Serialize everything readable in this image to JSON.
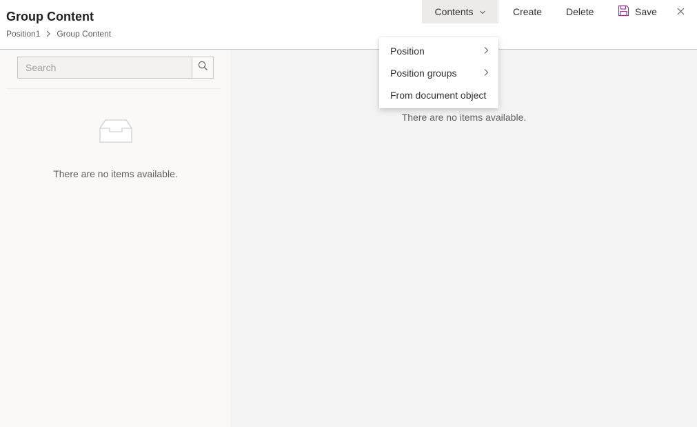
{
  "header": {
    "title": "Group Content",
    "breadcrumb": [
      "Position1",
      "Group Content"
    ]
  },
  "toolbar": {
    "contents_label": "Contents",
    "create_label": "Create",
    "delete_label": "Delete",
    "save_label": "Save"
  },
  "contents_menu": {
    "items": [
      {
        "label": "Position",
        "has_submenu": true
      },
      {
        "label": "Position groups",
        "has_submenu": true
      },
      {
        "label": "From document object",
        "has_submenu": false
      }
    ]
  },
  "left_panel": {
    "search_placeholder": "Search",
    "empty_message": "There are no items available."
  },
  "right_panel": {
    "empty_message": "There are no items available."
  },
  "colors": {
    "save_icon": "#8a3d8f",
    "active_button_bg": "#edebe9",
    "left_bg": "#faf9f8",
    "right_bg": "#f3f3f3"
  }
}
